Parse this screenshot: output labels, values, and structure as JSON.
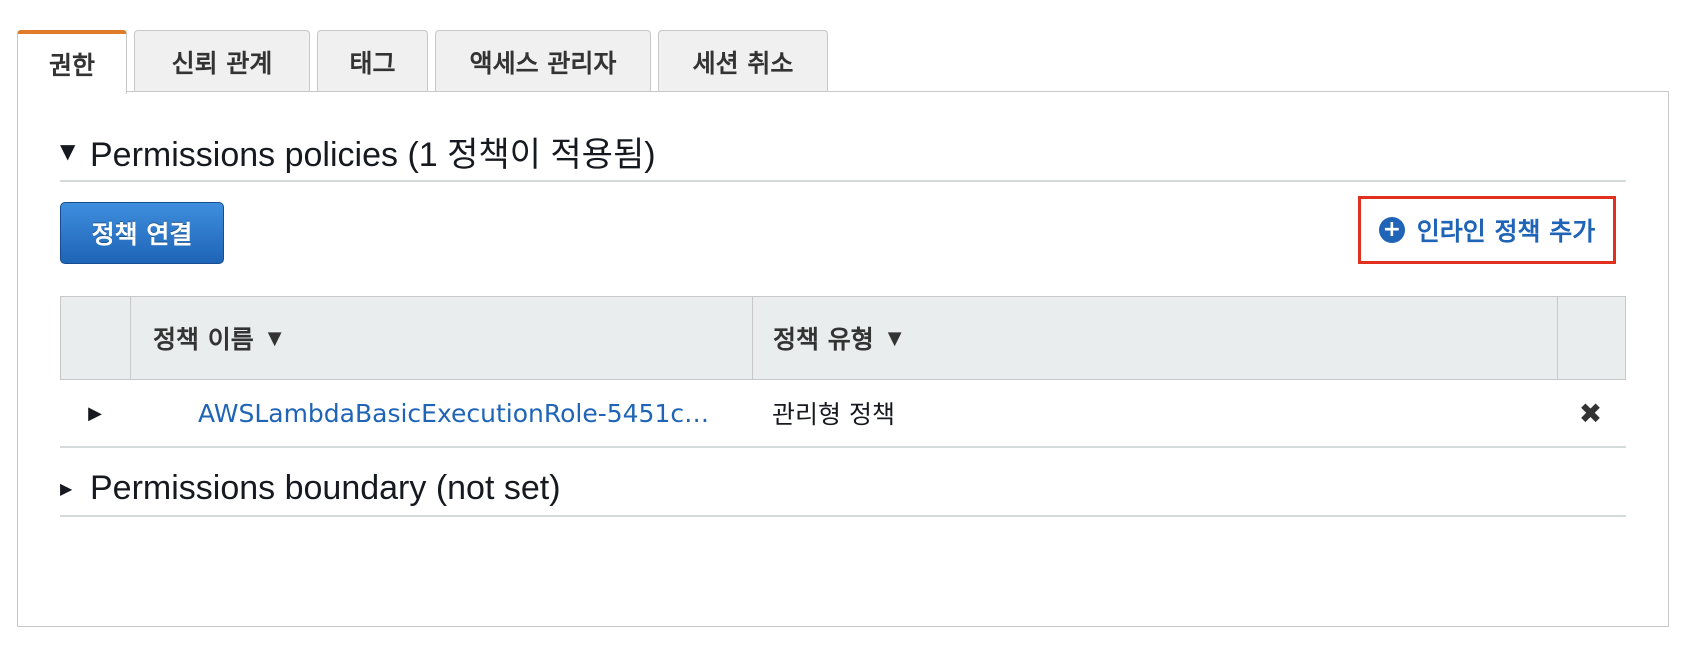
{
  "tabs": [
    {
      "label": "권한",
      "active": true
    },
    {
      "label": "신뢰 관계",
      "active": false
    },
    {
      "label": "태그",
      "active": false
    },
    {
      "label": "액세스 관리자",
      "active": false
    },
    {
      "label": "세션 취소",
      "active": false
    }
  ],
  "permissions_section": {
    "title": "Permissions policies (1 정책이 적용됨)",
    "caret_icon": "caret-down-icon",
    "attach_button_label": "정책 연결",
    "inline_add_label": "인라인 정책 추가",
    "inline_add_icon": "plus-circle-icon",
    "table": {
      "columns": [
        "정책 이름",
        "정책 유형"
      ],
      "rows": [
        {
          "name": "AWSLambdaBasicExecutionRole-5451c…",
          "type": "관리형 정책"
        }
      ]
    }
  },
  "boundary_section": {
    "title": "Permissions boundary (not set)",
    "caret_icon": "caret-right-icon"
  },
  "colors": {
    "tab_accent": "#e07b28",
    "link_blue": "#1f64b6",
    "highlight_border": "#e0301e",
    "primary_button": "#1f64b6"
  }
}
